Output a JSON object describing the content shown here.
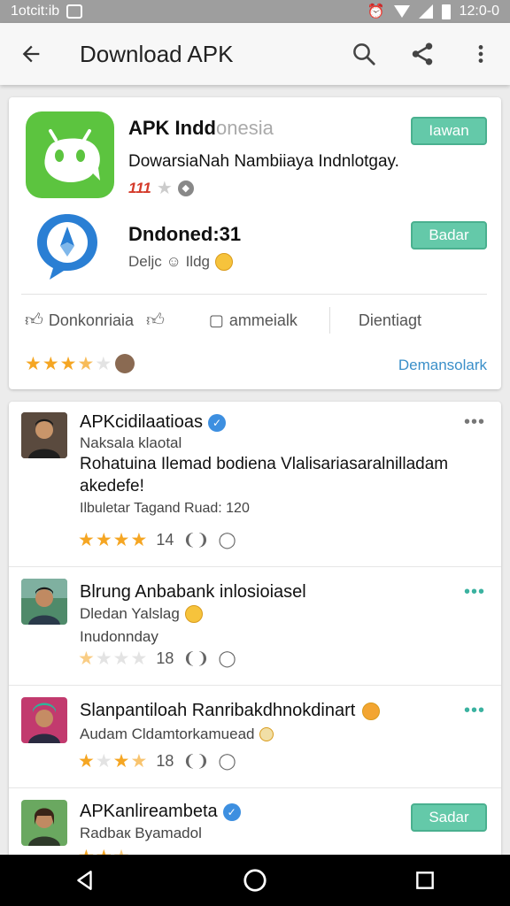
{
  "status_bar": {
    "left_text": "1otcit:ib",
    "time": "12:0-0"
  },
  "app_bar": {
    "back_icon": "arrow-left-icon",
    "title": "Download APK",
    "actions": [
      "search-icon",
      "share-icon",
      "more-vert-icon"
    ]
  },
  "top_card": {
    "app1": {
      "title": "APK Indd",
      "title_faded": "onesia",
      "description": "DowarsiaNah Nambiiaya Indnlotgay.",
      "rating_text": "111",
      "button": "Iawan"
    },
    "app2": {
      "title": "Dndoned:31",
      "subtitle": "Deljc ☺ Ildg",
      "button": "Badar"
    },
    "actions": {
      "like": "Donkonriaia",
      "comment": "ammeialk",
      "share": "Dientiagt"
    },
    "rating": 3.5,
    "link": "Demansolark"
  },
  "posts": [
    {
      "name": "APKcidilaatioas",
      "verified": true,
      "subtitle": "Naksala klaotal",
      "body": "Rohatuina Ilemad bodiena Vlalisariasaralnilladam akedefe!",
      "meta": "Ilbuletar Tagand Ruad: 120",
      "rating": 4,
      "count": "14"
    },
    {
      "name": "Blrung Anbabank inlosioiasel",
      "verified": false,
      "subtitle": "Dledan Yalslag",
      "meta": "Inudonnday",
      "rating": 1,
      "count": "18"
    },
    {
      "name": "Slanpantiloah Ranribakdhnokdinart",
      "verified": false,
      "subtitle": "Audam Cldamtorkamuead",
      "rating": 3.5,
      "count": "18"
    },
    {
      "name": "APKanlireambeta",
      "verified": true,
      "subtitle": "Radbaк Byamadol",
      "button": "Sadar",
      "rating": 2.5
    }
  ],
  "colors": {
    "accent": "#64c9a9",
    "star": "#f5a623",
    "link": "#3a8fc9",
    "verified": "#3d8fe0"
  }
}
